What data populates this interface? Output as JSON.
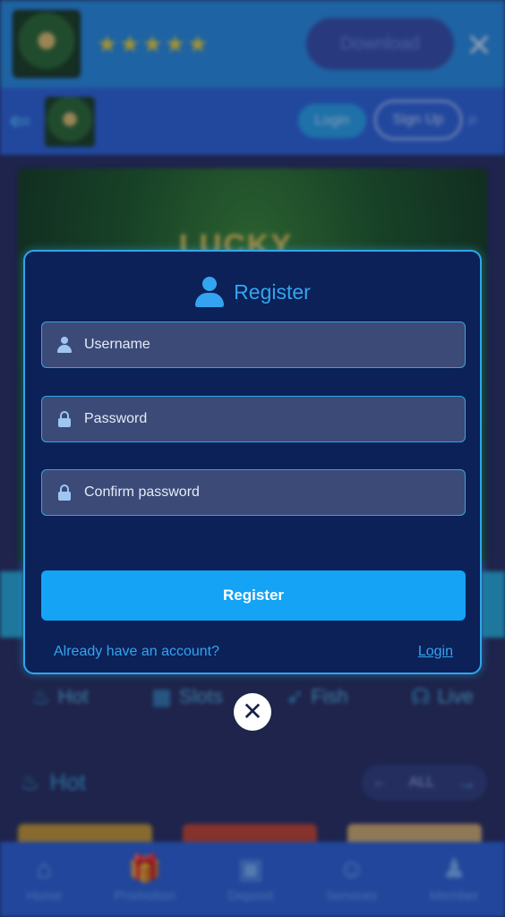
{
  "banner": {
    "rating_stars": "★★★★★",
    "download_label": "Download",
    "close_glyph": "✕"
  },
  "nav": {
    "back_icon": "⇐",
    "login_label": "Login",
    "signup_label": "Sign Up",
    "search_icon": "⌕"
  },
  "hero": {
    "logo_text": "LUCKY"
  },
  "categories": [
    {
      "icon": "flame-icon",
      "glyph": "♨",
      "label": "Hot"
    },
    {
      "icon": "slots-icon",
      "glyph": "▦",
      "label": "Slots"
    },
    {
      "icon": "fish-icon",
      "glyph": "➶",
      "label": "Fish"
    },
    {
      "icon": "live-icon",
      "glyph": "☊",
      "label": "Live"
    }
  ],
  "hot_section": {
    "title": "Hot",
    "all_label": "ALL",
    "prev_arrow": "←",
    "next_arrow": "→"
  },
  "bottom_nav": [
    {
      "icon": "home-icon",
      "glyph": "⌂",
      "label": "Home"
    },
    {
      "icon": "promotion-icon",
      "glyph": "🎁",
      "label": "Promotion"
    },
    {
      "icon": "deposit-icon",
      "glyph": "▣",
      "label": "Deposit"
    },
    {
      "icon": "services-icon",
      "glyph": "☺",
      "label": "Services"
    },
    {
      "icon": "member-icon",
      "glyph": "♟",
      "label": "Member"
    }
  ],
  "register_modal": {
    "title": "Register",
    "username_placeholder": "Username",
    "password_placeholder": "Password",
    "confirm_placeholder": "Confirm password",
    "submit_label": "Register",
    "have_account_text": "Already have an account?",
    "login_link": "Login",
    "close_glyph": "✕"
  },
  "colors": {
    "modal_bg": "#0b2158",
    "accent": "#34a4f0",
    "button": "#14a3f5",
    "field_bg": "#3c4a78"
  }
}
